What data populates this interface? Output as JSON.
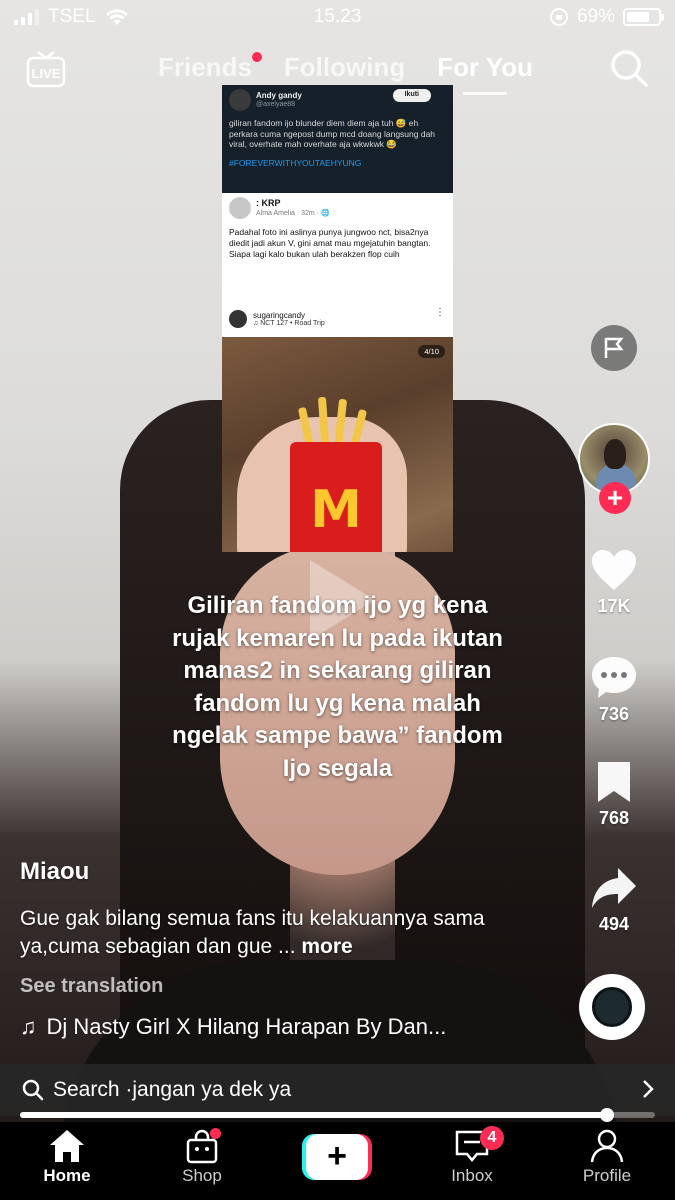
{
  "status_bar": {
    "carrier": "TSEL",
    "time": "15.23",
    "battery": "69%"
  },
  "top_nav": {
    "live_label": "LIVE",
    "tabs": [
      {
        "label": "Friends",
        "has_dot": true
      },
      {
        "label": "Following"
      },
      {
        "label": "For You",
        "active": true
      }
    ]
  },
  "embedded_screenshot": {
    "tweet": {
      "name": "Andy gandy",
      "handle": "@axelyae88",
      "follow": "Ikuti",
      "text": "giliran fandom ijo blunder diem diem aja tuh 😅 eh perkara cuma ngepost dump mcd doang langsung dah viral, overhate mah overhate aja wkwkwk 😂",
      "hashtag": "#FOREVERWITHYOUTAEHYUNG"
    },
    "fb_post": {
      "name": ": KRP",
      "sub": "Alma Amelia · 32m · 🌐",
      "text": "Padahal foto ini aslinya punya jungwoo nct, bisa2nya diedit jadi akun V, gini amat mau mgejatuhin bangtan. Siapa lagi kalo bukan ulah berakzen flop cuih"
    },
    "ig_post": {
      "user": "sugaringcandy",
      "song": "♫ NCT 127 • Road Trip",
      "page": "4/10"
    }
  },
  "caption": "Giliran fandom ijo yg kena rujak kemaren lu pada ikutan manas2 in sekarang giliran fandom lu yg kena malah ngelak sampe bawa” fandom Ijo segala",
  "rail": {
    "likes": "17K",
    "comments": "736",
    "saves": "768",
    "shares": "494"
  },
  "post": {
    "author": "Miaou",
    "description": "Gue gak bilang semua fans itu kelakuannya sama ya,cuma sebagian dan gue ...",
    "more": "more",
    "see_translation": "See translation",
    "music": "Dj Nasty Girl X Hilang Harapan By Dan..."
  },
  "search": {
    "text": "Search ·jangan ya dek ya"
  },
  "playback_progress": 0.925,
  "bottom_nav": {
    "home": "Home",
    "shop": "Shop",
    "inbox": "Inbox",
    "inbox_badge": "4",
    "profile": "Profile"
  },
  "colors": {
    "accent_red": "#fe2c55",
    "accent_cyan": "#25f4ee"
  }
}
